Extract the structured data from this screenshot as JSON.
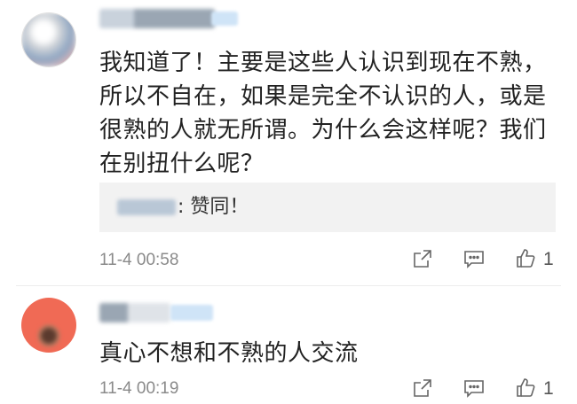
{
  "comments": [
    {
      "text": "我知道了！主要是这些人认识到现在不熟，所以不自在，如果是完全不认识的人，或是很熟的人就无所谓。为什么会这样呢？我们在别扭什么呢？",
      "reply": {
        "text": ": 赞同！"
      },
      "timestamp": "11-4 00:58",
      "like_count": "1"
    },
    {
      "text": "真心不想和不熟的人交流",
      "timestamp": "11-4 00:19",
      "like_count": "1"
    }
  ],
  "icons": {
    "share": "share-icon",
    "comment": "comment-icon",
    "like": "thumbs-up-icon"
  },
  "colors": {
    "avatar2": "#f06a55",
    "meta_text": "#8a8a8a",
    "reply_bg": "#f2f2f2"
  }
}
